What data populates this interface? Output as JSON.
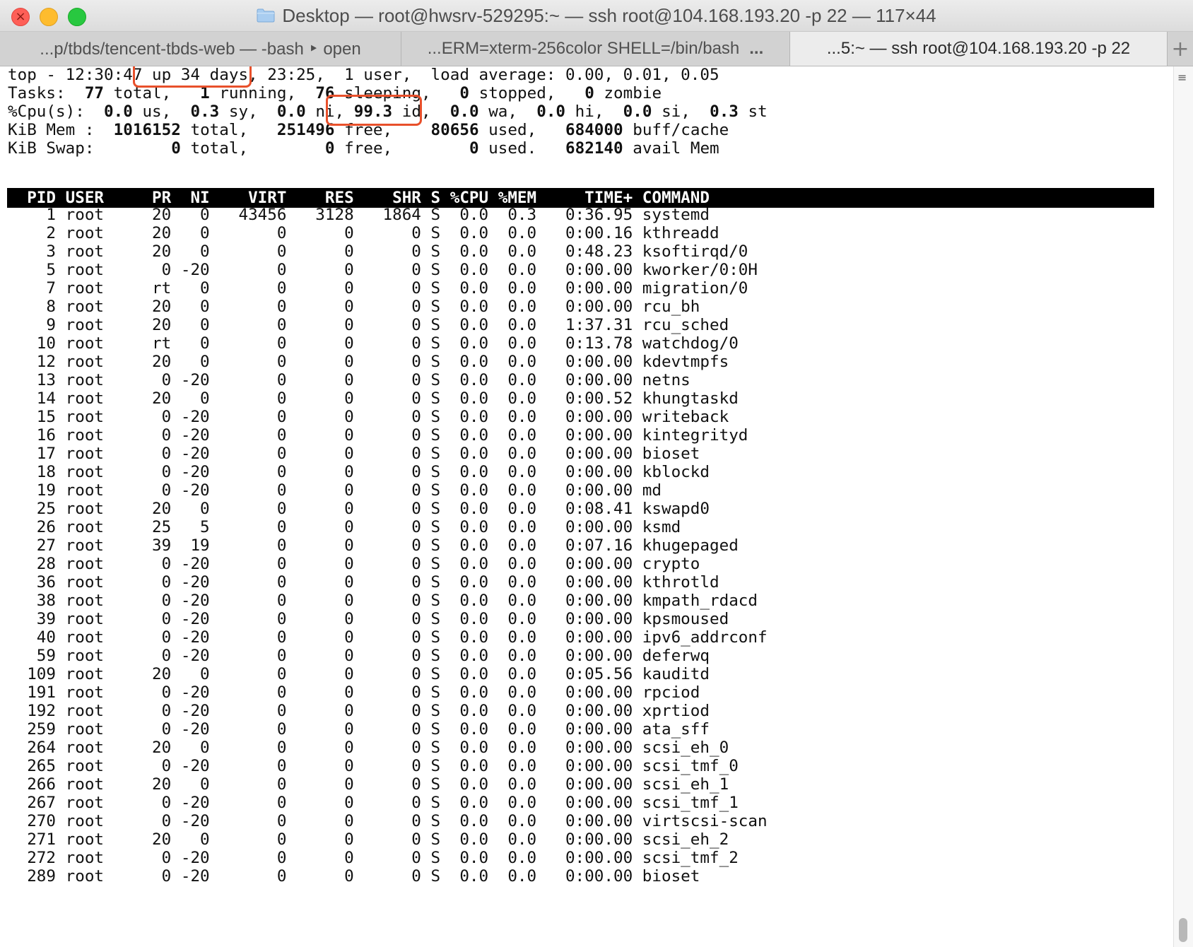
{
  "window": {
    "title": "Desktop — root@hwsrv-529295:~ — ssh root@104.168.193.20 -p 22 — 117×44",
    "close_glyph": "×",
    "icons": [
      "close-icon",
      "minimize-icon",
      "zoom-icon",
      "folder-icon",
      "new-tab-icon",
      "more-icon",
      "scroll-menu-icon"
    ]
  },
  "tabs": [
    {
      "label": "...p/tbds/tencent-tbds-web — -bash ‣ open"
    },
    {
      "label": "...ERM=xterm-256color SHELL=/bin/bash",
      "more": "..."
    },
    {
      "label": "...5:~ — ssh root@104.168.193.20 -p 22"
    }
  ],
  "new_tab_label": "+",
  "scroll_menu_glyph": "≡",
  "colors": {
    "highlight": "#e8502b",
    "header_bg": "#000000"
  },
  "top": {
    "summary_lines": [
      [
        {
          "t": "top - 12:30:47 up 34 days, 23:25,  1 user,  load average: 0.00, 0.01, 0.05",
          "b": false
        }
      ],
      [
        {
          "t": "Tasks: ",
          "b": false
        },
        {
          "t": " 77",
          "b": true
        },
        {
          "t": " total,   ",
          "b": false
        },
        {
          "t": "1",
          "b": true
        },
        {
          "t": " running,  ",
          "b": false
        },
        {
          "t": "76",
          "b": true
        },
        {
          "t": " sleeping,   ",
          "b": false
        },
        {
          "t": "0",
          "b": true
        },
        {
          "t": " stopped,   ",
          "b": false
        },
        {
          "t": "0",
          "b": true
        },
        {
          "t": " zombie",
          "b": false
        }
      ],
      [
        {
          "t": "%Cpu(s):  ",
          "b": false
        },
        {
          "t": "0.0",
          "b": true
        },
        {
          "t": " us,  ",
          "b": false
        },
        {
          "t": "0.3",
          "b": true
        },
        {
          "t": " sy,  ",
          "b": false
        },
        {
          "t": "0.0",
          "b": true
        },
        {
          "t": " ni, ",
          "b": false
        },
        {
          "t": "99.3",
          "b": true
        },
        {
          "t": " id,  ",
          "b": false
        },
        {
          "t": "0.0",
          "b": true
        },
        {
          "t": " wa,  ",
          "b": false
        },
        {
          "t": "0.0",
          "b": true
        },
        {
          "t": " hi,  ",
          "b": false
        },
        {
          "t": "0.0",
          "b": true
        },
        {
          "t": " si,  ",
          "b": false
        },
        {
          "t": "0.3",
          "b": true
        },
        {
          "t": " st",
          "b": false
        }
      ],
      [
        {
          "t": "KiB Mem : ",
          "b": false
        },
        {
          "t": " 1016152",
          "b": true
        },
        {
          "t": " total,  ",
          "b": false
        },
        {
          "t": " 251496",
          "b": true
        },
        {
          "t": " free,  ",
          "b": false
        },
        {
          "t": "  80656",
          "b": true
        },
        {
          "t": " used,  ",
          "b": false
        },
        {
          "t": " 684000",
          "b": true
        },
        {
          "t": " buff/cache",
          "b": false
        }
      ],
      [
        {
          "t": "KiB Swap:",
          "b": false
        },
        {
          "t": "        0",
          "b": true
        },
        {
          "t": " total,  ",
          "b": false
        },
        {
          "t": "      0",
          "b": true
        },
        {
          "t": " free,  ",
          "b": false
        },
        {
          "t": "      0",
          "b": true
        },
        {
          "t": " used.  ",
          "b": false
        },
        {
          "t": " 682140",
          "b": true
        },
        {
          "t": " avail Mem",
          "b": false
        }
      ]
    ],
    "columns": [
      "PID",
      "USER",
      "PR",
      "NI",
      "VIRT",
      "RES",
      "SHR",
      "S",
      "%CPU",
      "%MEM",
      "TIME+",
      "COMMAND"
    ],
    "processes": [
      [
        "1",
        "root",
        "20",
        "0",
        "43456",
        "3128",
        "1864",
        "S",
        "0.0",
        "0.3",
        "0:36.95",
        "systemd"
      ],
      [
        "2",
        "root",
        "20",
        "0",
        "0",
        "0",
        "0",
        "S",
        "0.0",
        "0.0",
        "0:00.16",
        "kthreadd"
      ],
      [
        "3",
        "root",
        "20",
        "0",
        "0",
        "0",
        "0",
        "S",
        "0.0",
        "0.0",
        "0:48.23",
        "ksoftirqd/0"
      ],
      [
        "5",
        "root",
        "0",
        "-20",
        "0",
        "0",
        "0",
        "S",
        "0.0",
        "0.0",
        "0:00.00",
        "kworker/0:0H"
      ],
      [
        "7",
        "root",
        "rt",
        "0",
        "0",
        "0",
        "0",
        "S",
        "0.0",
        "0.0",
        "0:00.00",
        "migration/0"
      ],
      [
        "8",
        "root",
        "20",
        "0",
        "0",
        "0",
        "0",
        "S",
        "0.0",
        "0.0",
        "0:00.00",
        "rcu_bh"
      ],
      [
        "9",
        "root",
        "20",
        "0",
        "0",
        "0",
        "0",
        "S",
        "0.0",
        "0.0",
        "1:37.31",
        "rcu_sched"
      ],
      [
        "10",
        "root",
        "rt",
        "0",
        "0",
        "0",
        "0",
        "S",
        "0.0",
        "0.0",
        "0:13.78",
        "watchdog/0"
      ],
      [
        "12",
        "root",
        "20",
        "0",
        "0",
        "0",
        "0",
        "S",
        "0.0",
        "0.0",
        "0:00.00",
        "kdevtmpfs"
      ],
      [
        "13",
        "root",
        "0",
        "-20",
        "0",
        "0",
        "0",
        "S",
        "0.0",
        "0.0",
        "0:00.00",
        "netns"
      ],
      [
        "14",
        "root",
        "20",
        "0",
        "0",
        "0",
        "0",
        "S",
        "0.0",
        "0.0",
        "0:00.52",
        "khungtaskd"
      ],
      [
        "15",
        "root",
        "0",
        "-20",
        "0",
        "0",
        "0",
        "S",
        "0.0",
        "0.0",
        "0:00.00",
        "writeback"
      ],
      [
        "16",
        "root",
        "0",
        "-20",
        "0",
        "0",
        "0",
        "S",
        "0.0",
        "0.0",
        "0:00.00",
        "kintegrityd"
      ],
      [
        "17",
        "root",
        "0",
        "-20",
        "0",
        "0",
        "0",
        "S",
        "0.0",
        "0.0",
        "0:00.00",
        "bioset"
      ],
      [
        "18",
        "root",
        "0",
        "-20",
        "0",
        "0",
        "0",
        "S",
        "0.0",
        "0.0",
        "0:00.00",
        "kblockd"
      ],
      [
        "19",
        "root",
        "0",
        "-20",
        "0",
        "0",
        "0",
        "S",
        "0.0",
        "0.0",
        "0:00.00",
        "md"
      ],
      [
        "25",
        "root",
        "20",
        "0",
        "0",
        "0",
        "0",
        "S",
        "0.0",
        "0.0",
        "0:08.41",
        "kswapd0"
      ],
      [
        "26",
        "root",
        "25",
        "5",
        "0",
        "0",
        "0",
        "S",
        "0.0",
        "0.0",
        "0:00.00",
        "ksmd"
      ],
      [
        "27",
        "root",
        "39",
        "19",
        "0",
        "0",
        "0",
        "S",
        "0.0",
        "0.0",
        "0:07.16",
        "khugepaged"
      ],
      [
        "28",
        "root",
        "0",
        "-20",
        "0",
        "0",
        "0",
        "S",
        "0.0",
        "0.0",
        "0:00.00",
        "crypto"
      ],
      [
        "36",
        "root",
        "0",
        "-20",
        "0",
        "0",
        "0",
        "S",
        "0.0",
        "0.0",
        "0:00.00",
        "kthrotld"
      ],
      [
        "38",
        "root",
        "0",
        "-20",
        "0",
        "0",
        "0",
        "S",
        "0.0",
        "0.0",
        "0:00.00",
        "kmpath_rdacd"
      ],
      [
        "39",
        "root",
        "0",
        "-20",
        "0",
        "0",
        "0",
        "S",
        "0.0",
        "0.0",
        "0:00.00",
        "kpsmoused"
      ],
      [
        "40",
        "root",
        "0",
        "-20",
        "0",
        "0",
        "0",
        "S",
        "0.0",
        "0.0",
        "0:00.00",
        "ipv6_addrconf"
      ],
      [
        "59",
        "root",
        "0",
        "-20",
        "0",
        "0",
        "0",
        "S",
        "0.0",
        "0.0",
        "0:00.00",
        "deferwq"
      ],
      [
        "109",
        "root",
        "20",
        "0",
        "0",
        "0",
        "0",
        "S",
        "0.0",
        "0.0",
        "0:05.56",
        "kauditd"
      ],
      [
        "191",
        "root",
        "0",
        "-20",
        "0",
        "0",
        "0",
        "S",
        "0.0",
        "0.0",
        "0:00.00",
        "rpciod"
      ],
      [
        "192",
        "root",
        "0",
        "-20",
        "0",
        "0",
        "0",
        "S",
        "0.0",
        "0.0",
        "0:00.00",
        "xprtiod"
      ],
      [
        "259",
        "root",
        "0",
        "-20",
        "0",
        "0",
        "0",
        "S",
        "0.0",
        "0.0",
        "0:00.00",
        "ata_sff"
      ],
      [
        "264",
        "root",
        "20",
        "0",
        "0",
        "0",
        "0",
        "S",
        "0.0",
        "0.0",
        "0:00.00",
        "scsi_eh_0"
      ],
      [
        "265",
        "root",
        "0",
        "-20",
        "0",
        "0",
        "0",
        "S",
        "0.0",
        "0.0",
        "0:00.00",
        "scsi_tmf_0"
      ],
      [
        "266",
        "root",
        "20",
        "0",
        "0",
        "0",
        "0",
        "S",
        "0.0",
        "0.0",
        "0:00.00",
        "scsi_eh_1"
      ],
      [
        "267",
        "root",
        "0",
        "-20",
        "0",
        "0",
        "0",
        "S",
        "0.0",
        "0.0",
        "0:00.00",
        "scsi_tmf_1"
      ],
      [
        "270",
        "root",
        "0",
        "-20",
        "0",
        "0",
        "0",
        "S",
        "0.0",
        "0.0",
        "0:00.00",
        "virtscsi-scan"
      ],
      [
        "271",
        "root",
        "20",
        "0",
        "0",
        "0",
        "0",
        "S",
        "0.0",
        "0.0",
        "0:00.00",
        "scsi_eh_2"
      ],
      [
        "272",
        "root",
        "0",
        "-20",
        "0",
        "0",
        "0",
        "S",
        "0.0",
        "0.0",
        "0:00.00",
        "scsi_tmf_2"
      ],
      [
        "289",
        "root",
        "0",
        "-20",
        "0",
        "0",
        "0",
        "S",
        "0.0",
        "0.0",
        "0:00.00",
        "bioset"
      ]
    ]
  }
}
